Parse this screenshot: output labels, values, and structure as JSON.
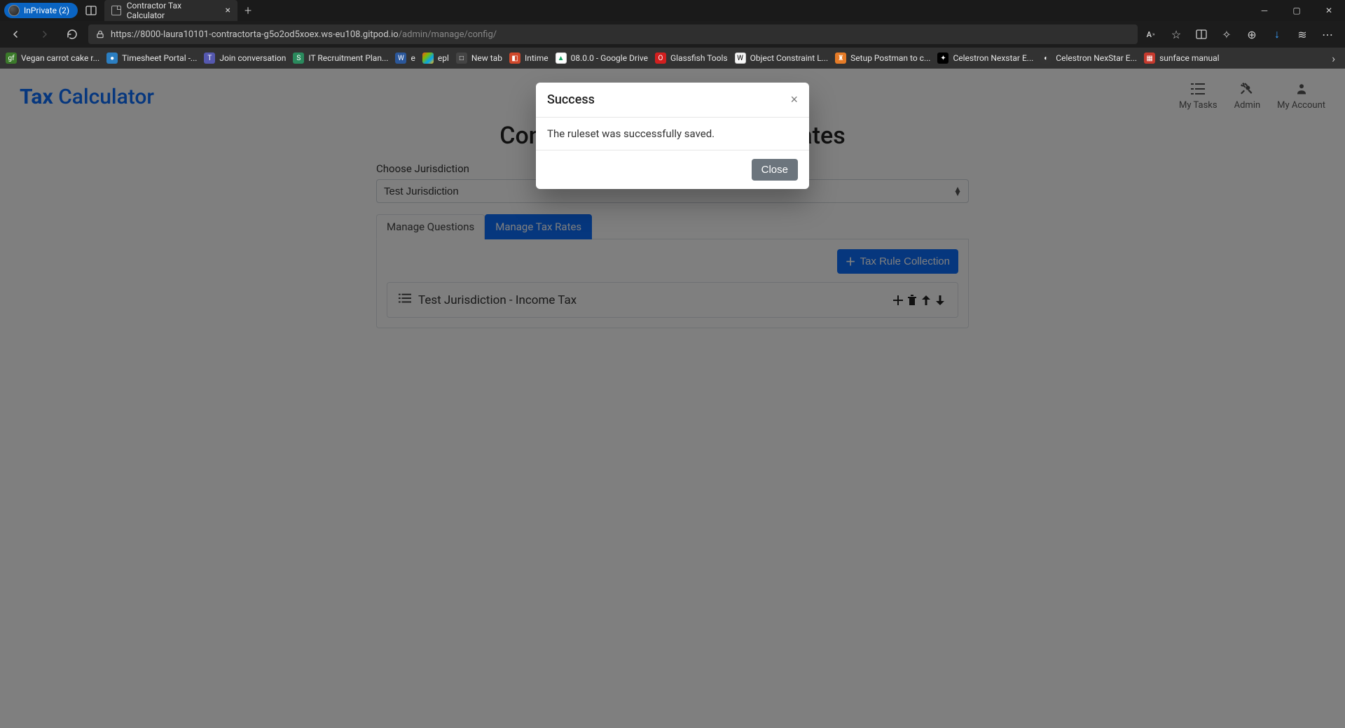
{
  "browser": {
    "inprivate_label": "InPrivate (2)",
    "tab_title": "Contractor Tax Calculator",
    "url_base": "https://8000-laura10101-contractorta-g5o2od5xoex.ws-eu108.gitpod.io",
    "url_path": "/admin/manage/config/"
  },
  "bookmarks": [
    {
      "label": "Vegan carrot cake r...",
      "color": "#3b7a2a"
    },
    {
      "label": "Timesheet Portal -...",
      "color": "#2b7ec1"
    },
    {
      "label": "Join conversation",
      "color": "#5558af"
    },
    {
      "label": "IT Recruitment Plan...",
      "color": "#2a8a5d"
    },
    {
      "label": "e",
      "color": "#2b579a"
    },
    {
      "label": "epl",
      "color": "#eeeeee"
    },
    {
      "label": "New tab",
      "color": "#444"
    },
    {
      "label": "Intime",
      "color": "#d0482b"
    },
    {
      "label": "08.0.0 - Google Drive",
      "color": "#13a461"
    },
    {
      "label": "Glassfish Tools",
      "color": "#d21f1f"
    },
    {
      "label": "Object Constraint L...",
      "color": "#f7f7f7"
    },
    {
      "label": "Setup Postman to c...",
      "color": "#e57b27"
    },
    {
      "label": "Celestron Nexstar E...",
      "color": "#000"
    },
    {
      "label": "Celestron NexStar E...",
      "color": "#333"
    },
    {
      "label": "sunface manual",
      "color": "#c63a2e"
    }
  ],
  "brand": {
    "word1": "Tax",
    "word2": "Calculator"
  },
  "header_nav": {
    "mytasks": "My Tasks",
    "admin": "Admin",
    "account": "My Account"
  },
  "page": {
    "title": "Configure Jurisdiction Tax Rates",
    "jurisdiction_label": "Choose Jurisdiction",
    "jurisdiction_value": "Test Jurisdiction"
  },
  "tabs": {
    "questions": "Manage Questions",
    "rates": "Manage Tax Rates"
  },
  "panel": {
    "add_button": "Tax Rule Collection",
    "rule_name": "Test Jurisdiction - Income Tax"
  },
  "modal": {
    "title": "Success",
    "body": "The ruleset was successfully saved.",
    "close": "Close"
  }
}
